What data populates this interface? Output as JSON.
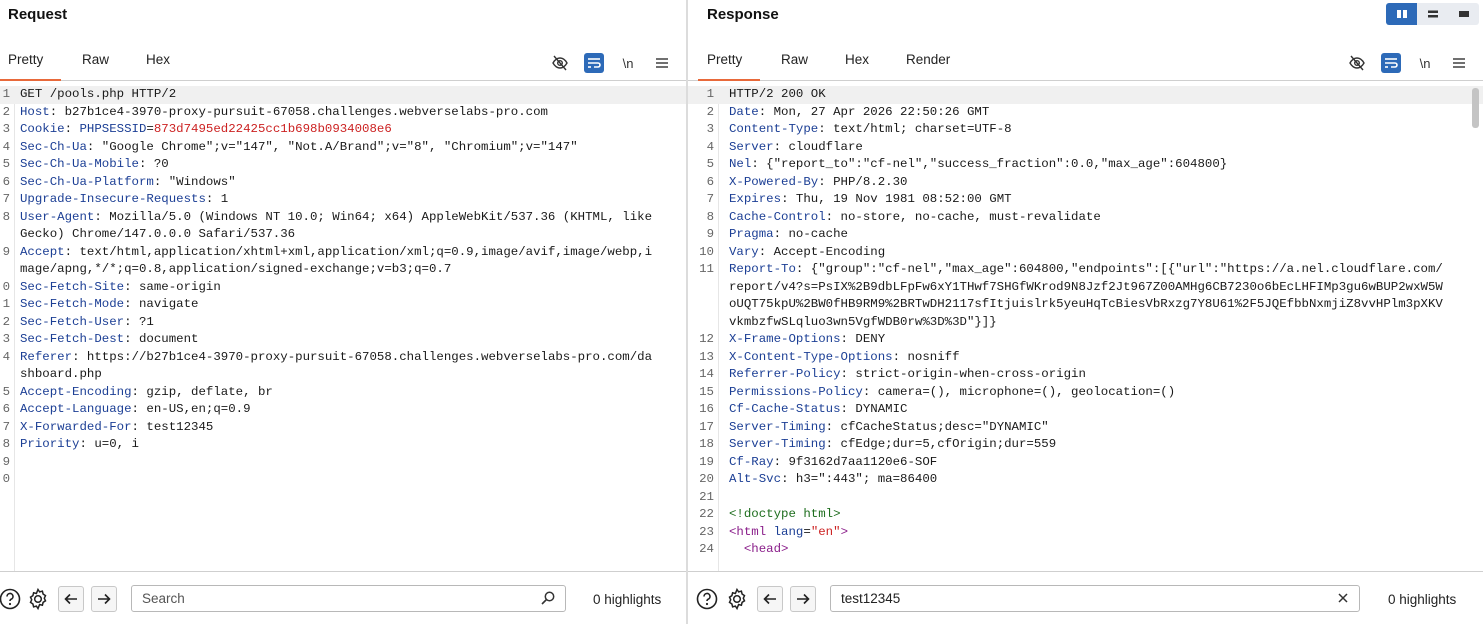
{
  "request": {
    "title": "Request",
    "tabs": [
      "Pretty",
      "Raw",
      "Hex"
    ],
    "newline_label": "\\n",
    "lines": [
      {
        "n": "1",
        "parts": [
          [
            "v",
            "GET /pools.php HTTP/2"
          ]
        ],
        "hl": true
      },
      {
        "n": "2",
        "parts": [
          [
            "k",
            "Host"
          ],
          [
            "v",
            ": b27b1ce4-3970-proxy-pursuit-67058.challenges.webverselabs-pro.com"
          ]
        ]
      },
      {
        "n": "3",
        "parts": [
          [
            "k",
            "Cookie"
          ],
          [
            "v",
            ": "
          ],
          [
            "k",
            "PHPSESSID"
          ],
          [
            "v",
            "="
          ],
          [
            "c",
            "873d7495ed22425cc1b698b0934008e6"
          ]
        ]
      },
      {
        "n": "4",
        "parts": [
          [
            "k",
            "Sec-Ch-Ua"
          ],
          [
            "v",
            ": \"Google Chrome\";v=\"147\", \"Not.A/Brand\";v=\"8\", \"Chromium\";v=\"147\""
          ]
        ]
      },
      {
        "n": "5",
        "parts": [
          [
            "k",
            "Sec-Ch-Ua-Mobile"
          ],
          [
            "v",
            ": ?0"
          ]
        ]
      },
      {
        "n": "6",
        "parts": [
          [
            "k",
            "Sec-Ch-Ua-Platform"
          ],
          [
            "v",
            ": \"Windows\""
          ]
        ]
      },
      {
        "n": "7",
        "parts": [
          [
            "k",
            "Upgrade-Insecure-Requests"
          ],
          [
            "v",
            ": 1"
          ]
        ]
      },
      {
        "n": "8",
        "parts": [
          [
            "k",
            "User-Agent"
          ],
          [
            "v",
            ": Mozilla/5.0 (Windows NT 10.0; Win64; x64) AppleWebKit/537.36 (KHTML, like Gecko) Chrome/147.0.0.0 Safari/537.36"
          ]
        ]
      },
      {
        "n": "9",
        "parts": [
          [
            "k",
            "Accept"
          ],
          [
            "v",
            ": text/html,application/xhtml+xml,application/xml;q=0.9,image/avif,image/webp,image/apng,*/*;q=0.8,application/signed-exchange;v=b3;q=0.7"
          ]
        ]
      },
      {
        "n": "0",
        "parts": [
          [
            "k",
            "Sec-Fetch-Site"
          ],
          [
            "v",
            ": same-origin"
          ]
        ]
      },
      {
        "n": "1",
        "parts": [
          [
            "k",
            "Sec-Fetch-Mode"
          ],
          [
            "v",
            ": navigate"
          ]
        ]
      },
      {
        "n": "2",
        "parts": [
          [
            "k",
            "Sec-Fetch-User"
          ],
          [
            "v",
            ": ?1"
          ]
        ]
      },
      {
        "n": "3",
        "parts": [
          [
            "k",
            "Sec-Fetch-Dest"
          ],
          [
            "v",
            ": document"
          ]
        ]
      },
      {
        "n": "4",
        "parts": [
          [
            "k",
            "Referer"
          ],
          [
            "v",
            ": https://b27b1ce4-3970-proxy-pursuit-67058.challenges.webverselabs-pro.com/dashboard.php"
          ]
        ]
      },
      {
        "n": "5",
        "parts": [
          [
            "k",
            "Accept-Encoding"
          ],
          [
            "v",
            ": gzip, deflate, br"
          ]
        ]
      },
      {
        "n": "6",
        "parts": [
          [
            "k",
            "Accept-Language"
          ],
          [
            "v",
            ": en-US,en;q=0.9"
          ]
        ]
      },
      {
        "n": "7",
        "parts": [
          [
            "k",
            "X-Forwarded-For"
          ],
          [
            "v",
            ": test12345"
          ]
        ]
      },
      {
        "n": "8",
        "parts": [
          [
            "k",
            "Priority"
          ],
          [
            "v",
            ": u=0, i"
          ]
        ]
      },
      {
        "n": "9",
        "parts": [
          [
            "v",
            ""
          ]
        ]
      },
      {
        "n": "0",
        "parts": [
          [
            "v",
            ""
          ]
        ]
      }
    ],
    "search": {
      "placeholder": "Search",
      "value": ""
    },
    "highlights": "0 highlights"
  },
  "response": {
    "title": "Response",
    "tabs": [
      "Pretty",
      "Raw",
      "Hex",
      "Render"
    ],
    "newline_label": "\\n",
    "lines": [
      {
        "n": "1",
        "parts": [
          [
            "v",
            "HTTP/2 200 OK"
          ]
        ],
        "hl": true
      },
      {
        "n": "2",
        "parts": [
          [
            "k",
            "Date"
          ],
          [
            "v",
            ": Mon, 27 Apr 2026 22:50:26 GMT"
          ]
        ]
      },
      {
        "n": "3",
        "parts": [
          [
            "k",
            "Content-Type"
          ],
          [
            "v",
            ": text/html; charset=UTF-8"
          ]
        ]
      },
      {
        "n": "4",
        "parts": [
          [
            "k",
            "Server"
          ],
          [
            "v",
            ": cloudflare"
          ]
        ]
      },
      {
        "n": "5",
        "parts": [
          [
            "k",
            "Nel"
          ],
          [
            "v",
            ": {\"report_to\":\"cf-nel\",\"success_fraction\":0.0,\"max_age\":604800}"
          ]
        ]
      },
      {
        "n": "6",
        "parts": [
          [
            "k",
            "X-Powered-By"
          ],
          [
            "v",
            ": PHP/8.2.30"
          ]
        ]
      },
      {
        "n": "7",
        "parts": [
          [
            "k",
            "Expires"
          ],
          [
            "v",
            ": Thu, 19 Nov 1981 08:52:00 GMT"
          ]
        ]
      },
      {
        "n": "8",
        "parts": [
          [
            "k",
            "Cache-Control"
          ],
          [
            "v",
            ": no-store, no-cache, must-revalidate"
          ]
        ]
      },
      {
        "n": "9",
        "parts": [
          [
            "k",
            "Pragma"
          ],
          [
            "v",
            ": no-cache"
          ]
        ]
      },
      {
        "n": "10",
        "parts": [
          [
            "k",
            "Vary"
          ],
          [
            "v",
            ": Accept-Encoding"
          ]
        ]
      },
      {
        "n": "11",
        "parts": [
          [
            "k",
            "Report-To"
          ],
          [
            "v",
            ": {\"group\":\"cf-nel\",\"max_age\":604800,\"endpoints\":[{\"url\":\"https://a.nel.cloudflare.com/report/v4?s=PsIX%2B9dbLFpFw6xY1THwf7SHGfWKrod9N8Jzf2Jt967Z00AMHg6CB7230o6bEcLHFIMp3gu6wBUP2wxW5WoUQT75kpU%2BW0fHB9RM9%2BRTwDH2117sfItjuislrk5yeuHqTcBiesVbRxzg7Y8U61%2F5JQEfbbNxmjiZ8vvHPlm3pXKVvkmbzfwSLqluo3wn5VgfWDB0rw%3D%3D\"}]}"
          ]
        ]
      },
      {
        "n": "12",
        "parts": [
          [
            "k",
            "X-Frame-Options"
          ],
          [
            "v",
            ": DENY"
          ]
        ]
      },
      {
        "n": "13",
        "parts": [
          [
            "k",
            "X-Content-Type-Options"
          ],
          [
            "v",
            ": nosniff"
          ]
        ]
      },
      {
        "n": "14",
        "parts": [
          [
            "k",
            "Referrer-Policy"
          ],
          [
            "v",
            ": strict-origin-when-cross-origin"
          ]
        ]
      },
      {
        "n": "15",
        "parts": [
          [
            "k",
            "Permissions-Policy"
          ],
          [
            "v",
            ": camera=(), microphone=(), geolocation=()"
          ]
        ]
      },
      {
        "n": "16",
        "parts": [
          [
            "k",
            "Cf-Cache-Status"
          ],
          [
            "v",
            ": DYNAMIC"
          ]
        ]
      },
      {
        "n": "17",
        "parts": [
          [
            "k",
            "Server-Timing"
          ],
          [
            "v",
            ": cfCacheStatus;desc=\"DYNAMIC\""
          ]
        ]
      },
      {
        "n": "18",
        "parts": [
          [
            "k",
            "Server-Timing"
          ],
          [
            "v",
            ": cfEdge;dur=5,cfOrigin;dur=559"
          ]
        ]
      },
      {
        "n": "19",
        "parts": [
          [
            "k",
            "Cf-Ray"
          ],
          [
            "v",
            ": 9f3162d7aa1120e6-SOF"
          ]
        ]
      },
      {
        "n": "20",
        "parts": [
          [
            "k",
            "Alt-Svc"
          ],
          [
            "v",
            ": h3=\":443\"; ma=86400"
          ]
        ]
      },
      {
        "n": "21",
        "parts": [
          [
            "v",
            ""
          ]
        ]
      },
      {
        "n": "22",
        "parts": [
          [
            "dt",
            "<!doctype html>"
          ]
        ]
      },
      {
        "n": "23",
        "parts": [
          [
            "tag",
            "<html "
          ],
          [
            "an",
            "lang"
          ],
          [
            "v",
            "="
          ],
          [
            "av",
            "\"en\""
          ],
          [
            "tag",
            ">"
          ]
        ]
      },
      {
        "n": "24",
        "parts": [
          [
            "v",
            "  "
          ],
          [
            "tag",
            "<head>"
          ]
        ]
      }
    ],
    "search": {
      "placeholder": "Search",
      "value": "test12345"
    },
    "highlights": "0 highlights"
  },
  "colors": {
    "accent": "#e8693a",
    "blue": "#2d6ab8",
    "key": "#1c3f95",
    "cookie": "#cc2222"
  }
}
